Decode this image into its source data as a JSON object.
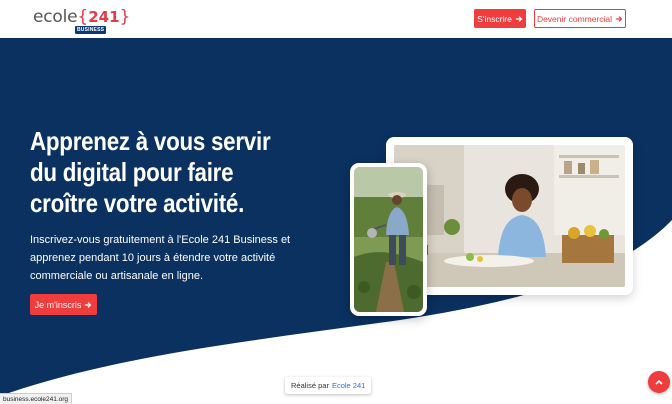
{
  "header": {
    "logo": {
      "word": "ecole",
      "brace_open": "{",
      "number": "241",
      "brace_close": "}",
      "badge": "BUSINESS"
    },
    "signup_label": "S'inscrire",
    "commercial_label": "Devenir commercial",
    "arrow_icon": "arrow-right-icon"
  },
  "hero": {
    "headline": "Apprenez à vous servir du digital pour faire croître votre activité.",
    "subtext": "Inscrivez-vous gratuitement à l'Ecole 241 Business et apprenez pendant 10 jours à étendre votre activité commerciale ou artisanale en ligne.",
    "cta_label": "Je m'inscris"
  },
  "credit": {
    "prefix": "Réalisé par",
    "link": "Ecole 241"
  },
  "status_bar": {
    "url": "business.ecole241.org"
  },
  "colors": {
    "navy": "#0b3161",
    "accent": "#ef3c3c",
    "link": "#2b6fd6"
  },
  "icons": {
    "scroll_top": "chevron-up-icon"
  }
}
